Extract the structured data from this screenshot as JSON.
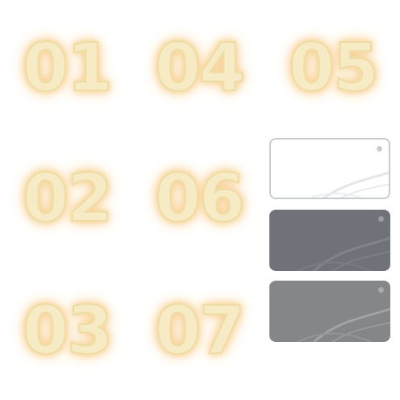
{
  "numbers": [
    "01",
    "04",
    "05",
    "02",
    "06",
    "03",
    "07"
  ],
  "swatches": [
    {
      "name": "white-swatch",
      "fill": "#ffffff"
    },
    {
      "name": "dark-gray-swatch",
      "fill": "#6f7379"
    },
    {
      "name": "gray-swatch",
      "fill": "#858688"
    }
  ],
  "colors": {
    "numeral_fill": "#f7ebc6",
    "numeral_glow": "#f7c77c",
    "background": "#ffffff"
  }
}
